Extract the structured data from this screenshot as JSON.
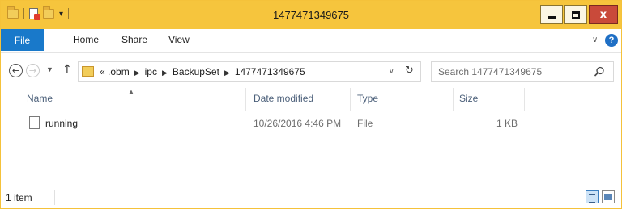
{
  "window": {
    "title": "1477471349675",
    "controls": {
      "minimize": "minimize",
      "maximize": "maximize",
      "close": "x"
    }
  },
  "ribbon": {
    "tabs": [
      {
        "label": "File",
        "active": true
      },
      {
        "label": "Home"
      },
      {
        "label": "Share"
      },
      {
        "label": "View"
      }
    ],
    "help_label": "?"
  },
  "navigation": {
    "back_glyph": "←",
    "forward_glyph": "→",
    "up_glyph": "↑",
    "address": {
      "overflow": "«",
      "crumbs": [
        ".obm",
        "ipc",
        "BackupSet",
        "1477471349675"
      ]
    },
    "refresh_glyph": "↻",
    "search": {
      "placeholder": "Search 1477471349675"
    }
  },
  "columns": {
    "name": "Name",
    "date_modified": "Date modified",
    "type": "Type",
    "size": "Size"
  },
  "files": [
    {
      "name": "running",
      "date_modified": "10/26/2016 4:46 PM",
      "type": "File",
      "size": "1 KB"
    }
  ],
  "status": {
    "item_count": "1 item"
  },
  "colors": {
    "titlebar": "#f6c53d",
    "file_tab": "#1979ca",
    "close_button": "#c94a3a"
  }
}
